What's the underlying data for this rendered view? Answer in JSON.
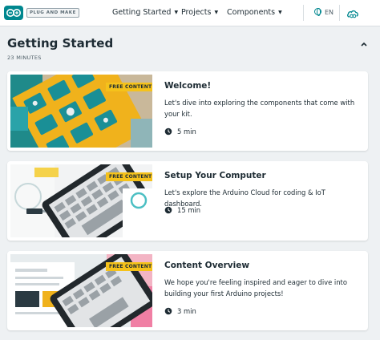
{
  "header": {
    "brand": "PLUG AND MAKE",
    "nav": [
      {
        "label": "Getting Started"
      },
      {
        "label": "Projects"
      },
      {
        "label": "Components"
      }
    ],
    "language": "EN"
  },
  "section": {
    "title": "Getting Started",
    "duration": "23 MINUTES"
  },
  "cards": [
    {
      "badge": "FREE CONTENT",
      "title": "Welcome!",
      "description": "Let's dive into exploring the components that come with your kit.",
      "duration": "5 min"
    },
    {
      "badge": "FREE CONTENT",
      "title": "Setup Your Computer",
      "description": "Let's explore the Arduino Cloud for coding & IoT dashboard.",
      "duration": "15 min"
    },
    {
      "badge": "FREE CONTENT",
      "title": "Content Overview",
      "description": "We hope you're feeling inspired and eager to dive into building your first Arduino projects!",
      "duration": "3 min"
    }
  ],
  "colors": {
    "accent": "#00878f",
    "badge": "#f5c21b",
    "background": "#eef1f3"
  },
  "icons": [
    "arduino-logo",
    "globe-icon",
    "cloud-icon",
    "chevron-up-icon",
    "clock-icon"
  ]
}
